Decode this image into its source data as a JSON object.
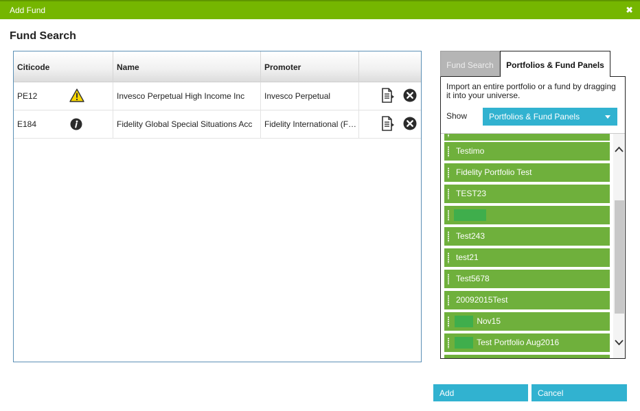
{
  "dialog": {
    "title": "Add Fund",
    "close_icon": "close-icon",
    "heading": "Fund Search"
  },
  "table": {
    "columns": [
      "Citicode",
      "Name",
      "Promoter",
      ""
    ],
    "rows": [
      {
        "citicode": "PE12",
        "status_icon": "warning-icon",
        "name": "Invesco Perpetual High Income Inc",
        "promoter": "Invesco Perpetual",
        "actions": [
          "document-icon",
          "remove-icon"
        ]
      },
      {
        "citicode": "E184",
        "status_icon": "info-icon",
        "name": "Fidelity Global Special Situations Acc",
        "promoter": "Fidelity International (F…",
        "actions": [
          "document-icon",
          "remove-icon"
        ]
      }
    ]
  },
  "panel": {
    "tabs": [
      {
        "label": "Fund Search",
        "active": false
      },
      {
        "label": "Portfolios & Fund Panels",
        "active": true
      }
    ],
    "description": "Import an entire portfolio or a fund by dragging it into your universe.",
    "show_label": "Show",
    "show_selected": "Portfolios & Fund Panels",
    "items": [
      {
        "label": ""
      },
      {
        "label": "Testimo"
      },
      {
        "label": "Fidelity Portfolio Test"
      },
      {
        "label": "TEST23"
      },
      {
        "label": ""
      },
      {
        "label": "Test243"
      },
      {
        "label": "test21"
      },
      {
        "label": "Test5678"
      },
      {
        "label": "20092015Test"
      },
      {
        "label": "Nov15"
      },
      {
        "label": "Test Portfolio Aug2016"
      },
      {
        "label": ""
      }
    ]
  },
  "buttons": {
    "add_label": "Add",
    "cancel_label": "Cancel"
  },
  "colors": {
    "titlebar": "#75b600",
    "list_item": "#6fb03c",
    "button": "#31b2d0",
    "table_border": "#5a8fb5"
  }
}
